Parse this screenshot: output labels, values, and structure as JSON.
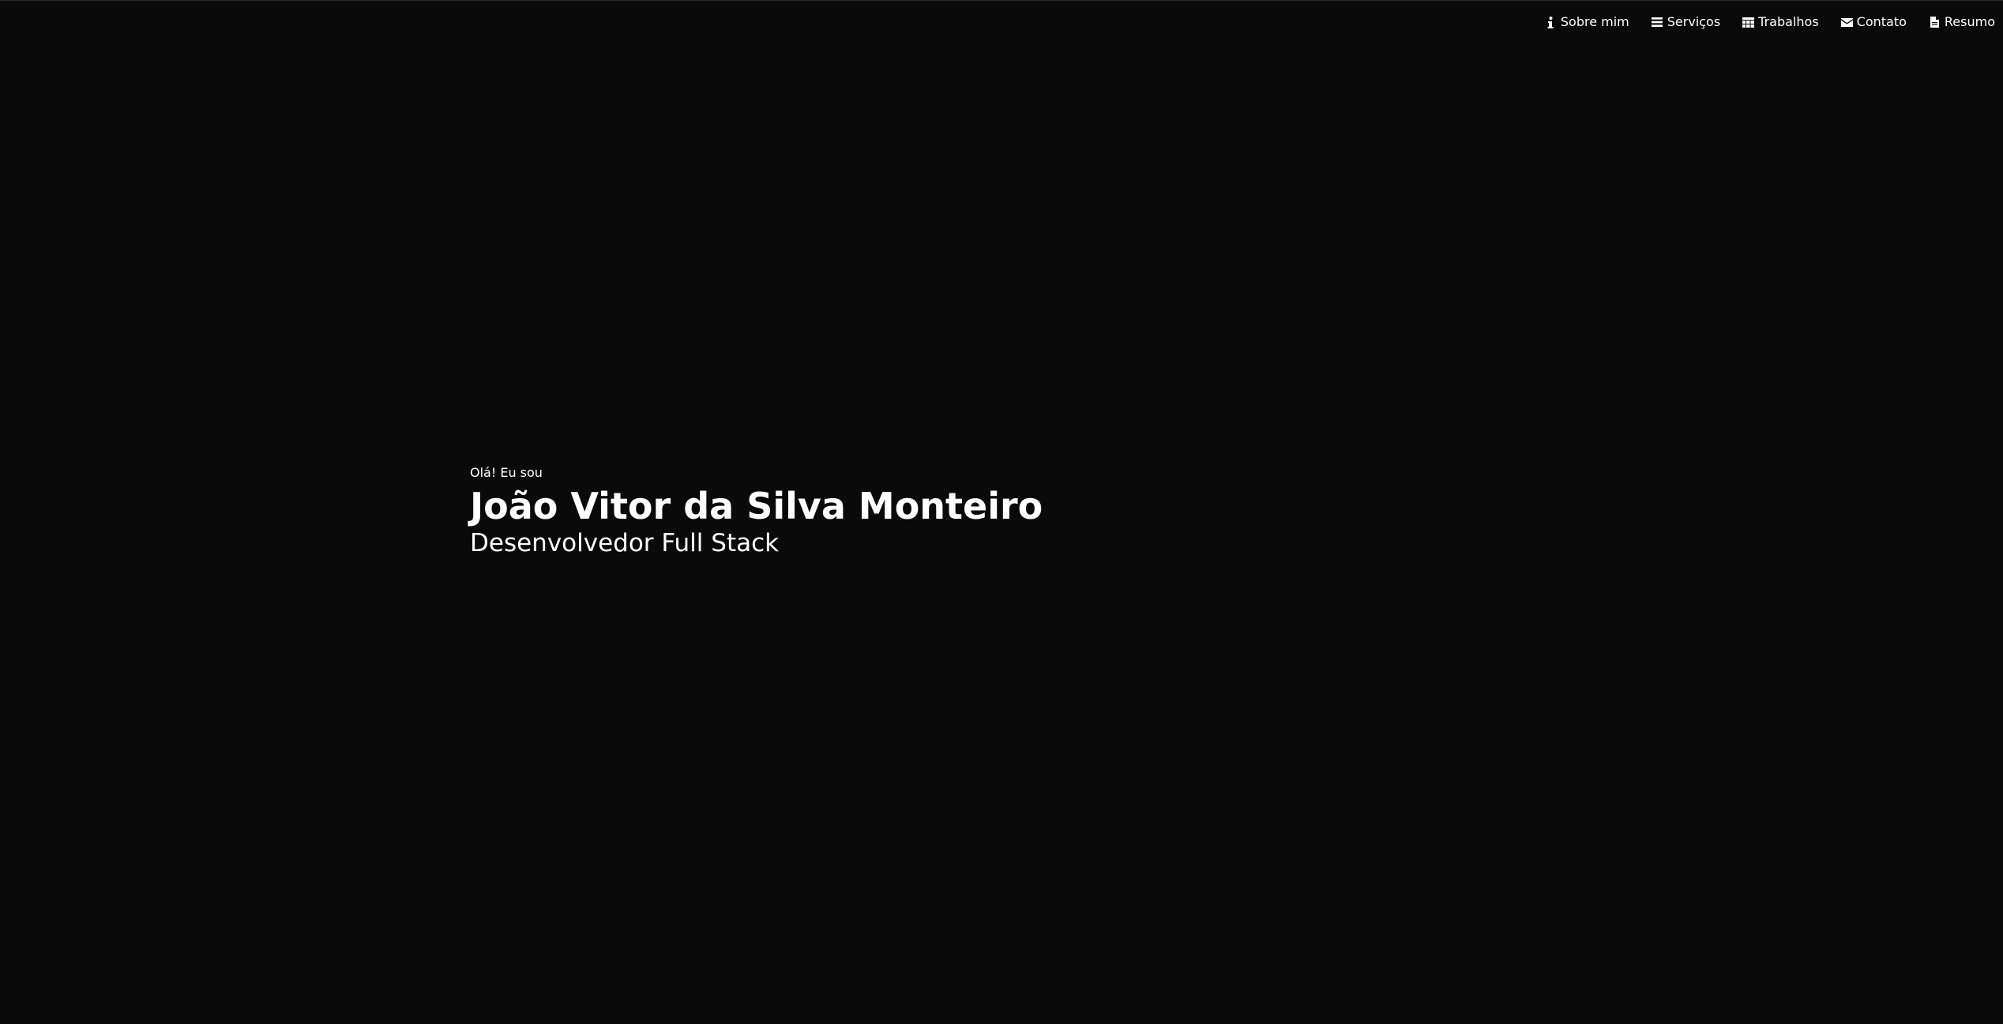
{
  "nav": {
    "items": [
      {
        "label": "Sobre mim",
        "icon": "info-icon"
      },
      {
        "label": "Serviços",
        "icon": "list-icon"
      },
      {
        "label": "Trabalhos",
        "icon": "table-icon"
      },
      {
        "label": "Contato",
        "icon": "envelope-icon"
      },
      {
        "label": "Resumo",
        "icon": "file-icon"
      }
    ]
  },
  "hero": {
    "greeting": "Olá! Eu sou",
    "name": "João Vitor da Silva Monteiro",
    "role": "Desenvolvedor Full Stack"
  },
  "colors": {
    "background": "#0a0a0a",
    "text": "#ffffff"
  }
}
